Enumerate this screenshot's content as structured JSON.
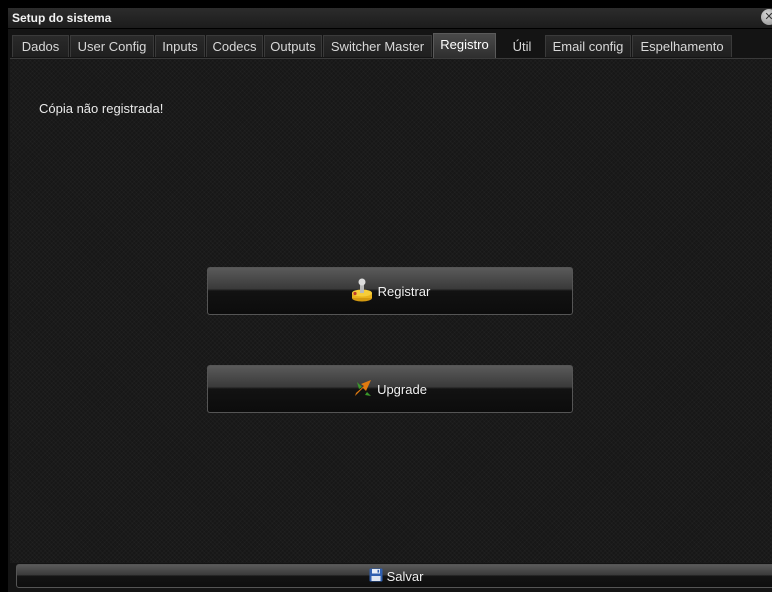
{
  "window": {
    "title": "Setup do sistema",
    "close_symbol": "✕"
  },
  "tabs": [
    {
      "label": "Dados",
      "active": false
    },
    {
      "label": "User Config",
      "active": false
    },
    {
      "label": "Inputs",
      "active": false
    },
    {
      "label": "Codecs",
      "active": false
    },
    {
      "label": "Outputs",
      "active": false
    },
    {
      "label": "Switcher Master",
      "active": false
    },
    {
      "label": "Registro",
      "active": true
    },
    {
      "label": "Útil",
      "active": false
    },
    {
      "label": "Email config",
      "active": false
    },
    {
      "label": "Espelhamento",
      "active": false
    }
  ],
  "content": {
    "status_text": "Cópia não registrada!",
    "register_button": {
      "label": "Registrar",
      "icon": "joystick-icon"
    },
    "upgrade_button": {
      "label": "Upgrade",
      "icon": "upgrade-arrow-icon"
    }
  },
  "footer": {
    "save_button": {
      "label": "Salvar",
      "icon": "floppy-disk-icon"
    }
  },
  "colors": {
    "background": "#171717",
    "text": "#e8e8e8",
    "border": "#555555"
  }
}
